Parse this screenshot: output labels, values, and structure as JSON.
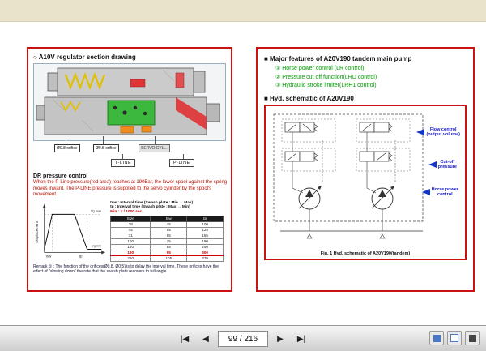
{
  "colors": {
    "page_border": "#cc1111",
    "feature_green": "#009a00",
    "label_blue": "#1818cc",
    "alert_red": "#cc0000",
    "band_beige": "#e9e3c9"
  },
  "left_page": {
    "title": "○ A10V regulator section drawing",
    "diagram": {
      "orifice_label_1": "Ø0.8 orifice",
      "orifice_label_2": "Ø0.5 orifice",
      "servo_label": "SERVO CYL...",
      "t_line_label": "T-LINE",
      "p_line_label": "P-LINE"
    },
    "dr": {
      "heading": "DR pressure control",
      "body": "When the P-Line pressure(red area) reaches at 190Bar, the lower spool against the spring moves inward. The P-LINE pressure is supplied to the servo cylinder by the spool's movement."
    },
    "graph": {
      "ylabel": "Displacement",
      "vg_max": "Vg max",
      "vg_min": "Vg min",
      "t1": "tsw",
      "t2": "tp"
    },
    "notes": {
      "line1": "tsw : Interval time (Swash plate : Min → Max)",
      "line2": "tp : Interval time (Swash plate : Max → Min)",
      "line3": "Min : 1 / 1000 sec."
    },
    "table": {
      "headers": [
        "Size",
        "tsw",
        "tp"
      ],
      "rows": [
        [
          "28",
          "45",
          "100"
        ],
        [
          "45",
          "55",
          "125"
        ],
        [
          "71",
          "65",
          "155"
        ],
        [
          "100",
          "75",
          "190"
        ],
        [
          "140",
          "85",
          "240"
        ],
        [
          "190",
          "95",
          "300"
        ],
        [
          "260",
          "105",
          "370"
        ]
      ]
    },
    "remark": "Remark ① : The function of the orifices(Ø0.8, Ø0.5) is to delay the interval time. These orifices have the effect of \"slowing down\" the rate that the swash plate recovers to full angle."
  },
  "right_page": {
    "features_title": "■ Major features of A20V190 tandem main pump",
    "features": [
      "① Horse power control (LR control)",
      "② Pressure cut off function(LRD control)",
      "③ Hydraulic stroke limiter(LRH1 control)"
    ],
    "schematic_title": "■ Hyd. schematic of A20V190",
    "labels": [
      "Flow control\n(output volume)",
      "Cut-off\npressure",
      "Horse power\ncontrol"
    ],
    "caption": "Fig. 1 Hyd. schematic of A20V190(tandem)"
  },
  "toolbar": {
    "page_display": "99 / 216",
    "icons": {
      "first": "|◀",
      "prev": "◀",
      "next": "▶",
      "last": "▶|"
    }
  }
}
